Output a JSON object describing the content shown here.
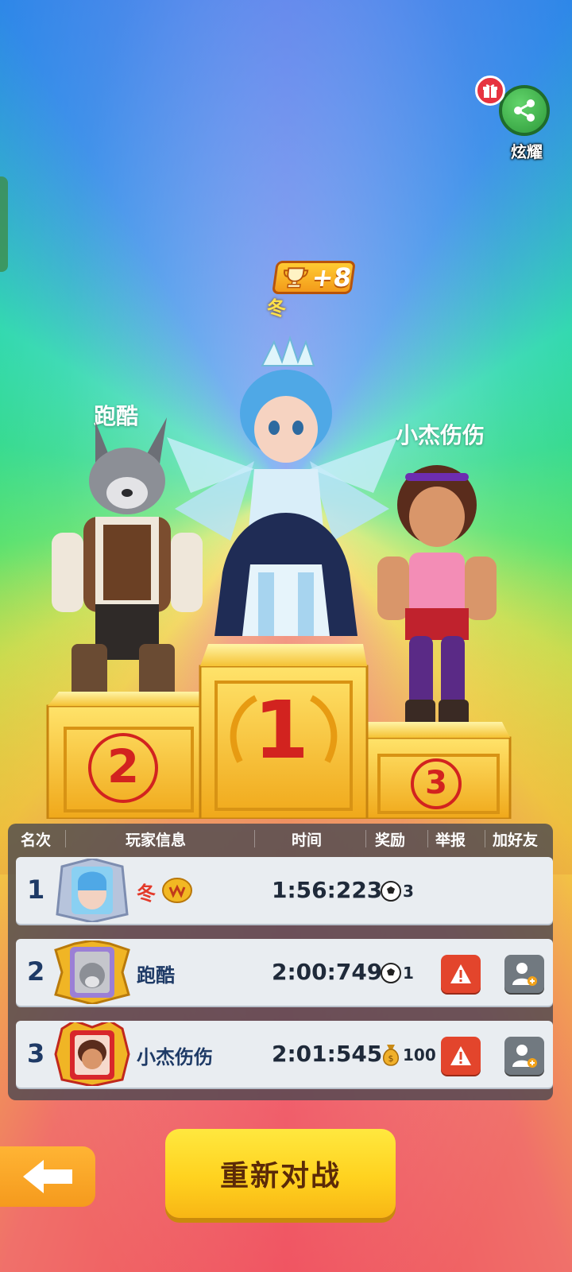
{
  "share": {
    "label": "炫耀"
  },
  "award": {
    "trophy_gain": "+8",
    "winner_name": "冬"
  },
  "podium": {
    "names": {
      "first": "冬",
      "second": "跑酷",
      "third": "小杰伤伤"
    },
    "places": {
      "first": "1",
      "second": "2",
      "third": "3"
    }
  },
  "results": {
    "headers": [
      "名次",
      "玩家信息",
      "时间",
      "奖励",
      "举报",
      "加好友"
    ],
    "rows": [
      {
        "rank": "1",
        "name": "冬",
        "time": "1:56:223",
        "reward_icon": "soccer-ball-icon",
        "reward": "3"
      },
      {
        "rank": "2",
        "name": "跑酷",
        "time": "2:00:749",
        "reward_icon": "soccer-ball-icon",
        "reward": "1"
      },
      {
        "rank": "3",
        "name": "小杰伤伤",
        "time": "2:01:545",
        "reward_icon": "money-bag-icon",
        "reward": "100"
      }
    ]
  },
  "buttons": {
    "rematch": "重新对战",
    "back_icon": "back-arrow-icon"
  },
  "colors": {
    "rematch_bg": "#ffd21f",
    "report_bg": "#e3452c",
    "add_friend_bg": "#717980",
    "rank_text": "#1e3a66"
  }
}
